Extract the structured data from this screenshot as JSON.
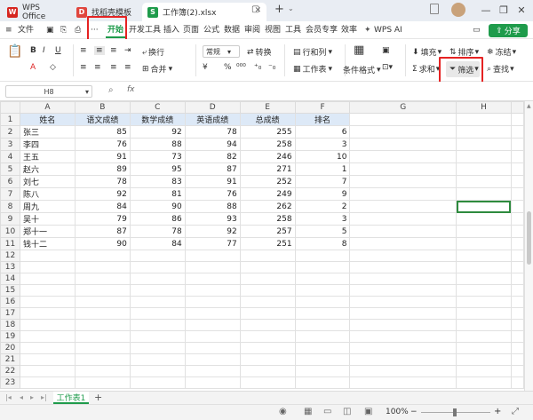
{
  "tabs": [
    {
      "label": "WPS Office",
      "icon": "wps-icon"
    },
    {
      "label": "找稻壳模板",
      "icon": "docer-icon"
    },
    {
      "label": "工作簿(2).xlsx",
      "icon": "sheet-icon"
    }
  ],
  "menu": {
    "file": "文件",
    "items": [
      "开始",
      "开发工具",
      "插入",
      "页面",
      "公式",
      "数据",
      "审阅",
      "视图",
      "工具",
      "会员专享",
      "效率"
    ],
    "ai": "WPS AI",
    "share": "分享"
  },
  "toolbar": {
    "number_format": "常规",
    "convert": "转换",
    "rows_cols": "行和列",
    "worksheet": "工作表",
    "wrap": "换行",
    "merge": "合并",
    "cond_format": "条件格式",
    "fill": "填充",
    "sort": "排序",
    "freeze": "冻结",
    "sum": "求和",
    "filter": "筛选",
    "find": "查找"
  },
  "formula": {
    "cell_ref": "H8",
    "fx": "fx",
    "value": ""
  },
  "sheet": {
    "columns": [
      "A",
      "B",
      "C",
      "D",
      "E",
      "F",
      "G",
      "H"
    ],
    "selected_col": "H",
    "selected_row": 8,
    "header_row": [
      "姓名",
      "语文成绩",
      "数学成绩",
      "英语成绩",
      "总成绩",
      "排名"
    ],
    "rows": [
      [
        "张三",
        "85",
        "92",
        "78",
        "255",
        "6"
      ],
      [
        "李四",
        "76",
        "88",
        "94",
        "258",
        "3"
      ],
      [
        "王五",
        "91",
        "73",
        "82",
        "246",
        "10"
      ],
      [
        "赵六",
        "89",
        "95",
        "87",
        "271",
        "1"
      ],
      [
        "刘七",
        "78",
        "83",
        "91",
        "252",
        "7"
      ],
      [
        "陈八",
        "92",
        "81",
        "76",
        "249",
        "9"
      ],
      [
        "周九",
        "84",
        "90",
        "88",
        "262",
        "2"
      ],
      [
        "吴十",
        "79",
        "86",
        "93",
        "258",
        "3"
      ],
      [
        "郑十一",
        "87",
        "78",
        "92",
        "257",
        "5"
      ],
      [
        "钱十二",
        "90",
        "84",
        "77",
        "251",
        "8"
      ]
    ],
    "total_rows": 23
  },
  "sheet_tab": "工作表1",
  "zoom": "100%"
}
